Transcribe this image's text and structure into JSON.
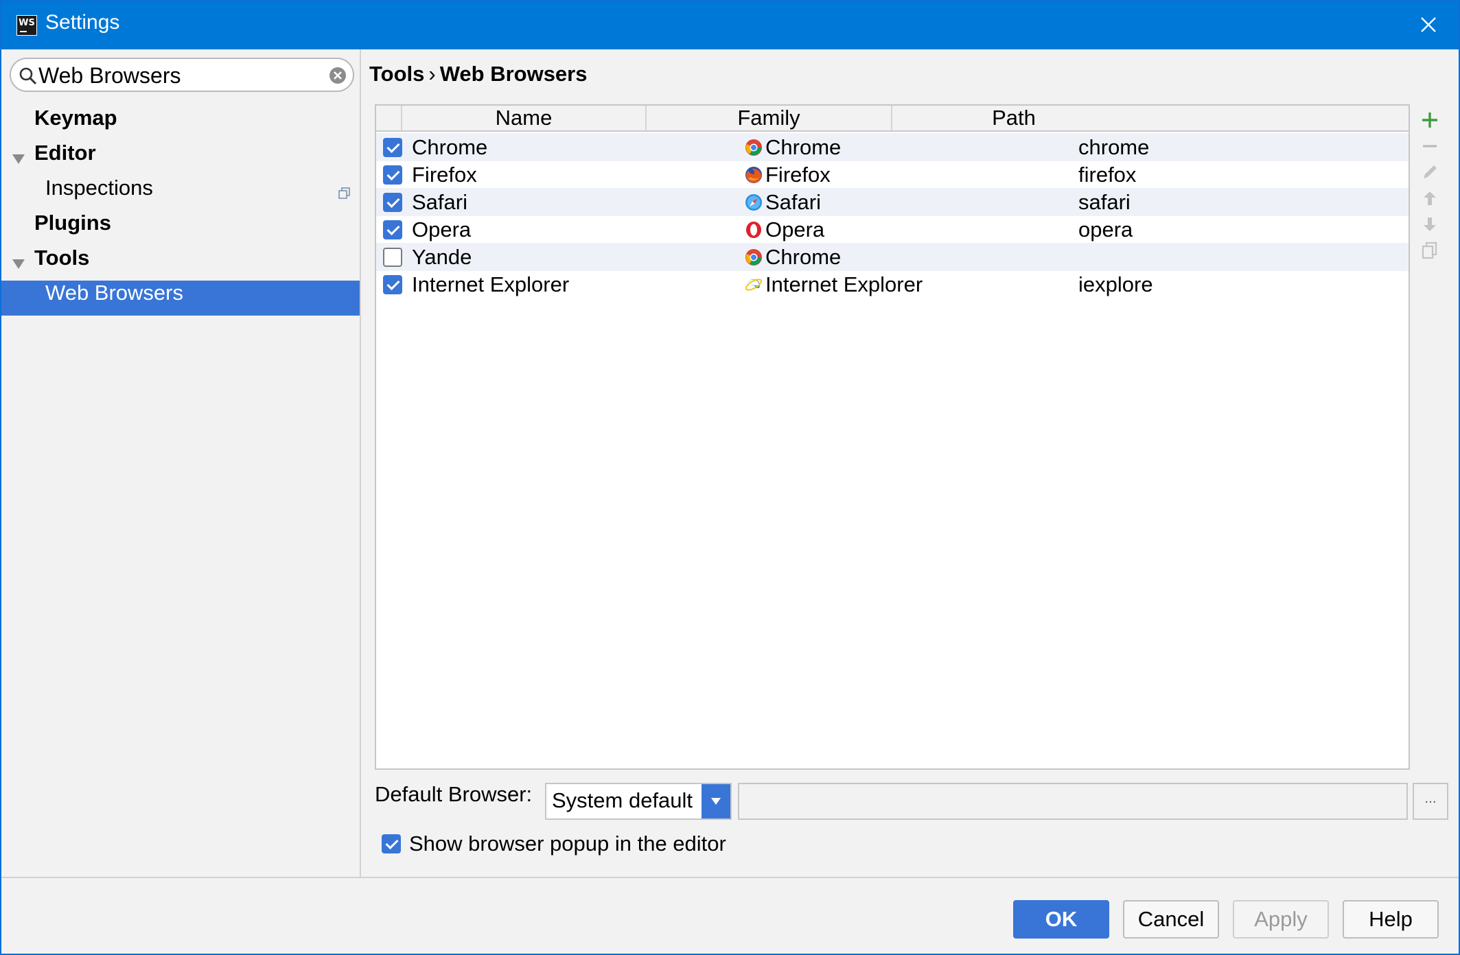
{
  "window": {
    "title": "Settings",
    "app_icon_label": "WS"
  },
  "search": {
    "value": "Web Browsers"
  },
  "tree": [
    {
      "label": "Keymap",
      "bold": true,
      "level": 0,
      "arrow": false
    },
    {
      "label": "Editor",
      "bold": true,
      "level": 0,
      "arrow": true
    },
    {
      "label": "Inspections",
      "bold": false,
      "level": 1,
      "arrow": false,
      "copy_icon": true
    },
    {
      "label": "Plugins",
      "bold": true,
      "level": 0,
      "arrow": false
    },
    {
      "label": "Tools",
      "bold": true,
      "level": 0,
      "arrow": true
    },
    {
      "label": "Web Browsers",
      "bold": false,
      "level": 1,
      "arrow": false,
      "selected": true
    }
  ],
  "breadcrumb": {
    "parent": "Tools",
    "separator": "›",
    "current": "Web Browsers"
  },
  "table": {
    "columns": [
      "Name",
      "Family",
      "Path"
    ],
    "rows": [
      {
        "checked": true,
        "name": "Chrome",
        "family": "Chrome",
        "family_icon": "chrome-icon",
        "path": "chrome"
      },
      {
        "checked": true,
        "name": "Firefox",
        "family": "Firefox",
        "family_icon": "firefox-icon",
        "path": "firefox"
      },
      {
        "checked": true,
        "name": "Safari",
        "family": "Safari",
        "family_icon": "safari-icon",
        "path": "safari"
      },
      {
        "checked": true,
        "name": "Opera",
        "family": "Opera",
        "family_icon": "opera-icon",
        "path": "opera"
      },
      {
        "checked": false,
        "name": "Yande",
        "family": "Chrome",
        "family_icon": "chrome-icon",
        "path": ""
      },
      {
        "checked": true,
        "name": "Internet Explorer",
        "family": "Internet Explorer",
        "family_icon": "ie-icon",
        "path": "iexplore"
      }
    ]
  },
  "side_toolbar": [
    "add-icon",
    "remove-icon",
    "edit-icon",
    "move-up-icon",
    "move-down-icon",
    "copy-icon"
  ],
  "default_browser": {
    "label": "Default Browser:",
    "value": "System default",
    "path_value": "",
    "browse_label": "..."
  },
  "popup_option": {
    "label": "Show browser popup in the editor",
    "checked": true
  },
  "buttons": {
    "ok": "OK",
    "cancel": "Cancel",
    "apply": "Apply",
    "help": "Help"
  },
  "colors": {
    "titlebar": "#0078d7",
    "selection": "#3875d7",
    "add_green": "#3c9c3c"
  }
}
